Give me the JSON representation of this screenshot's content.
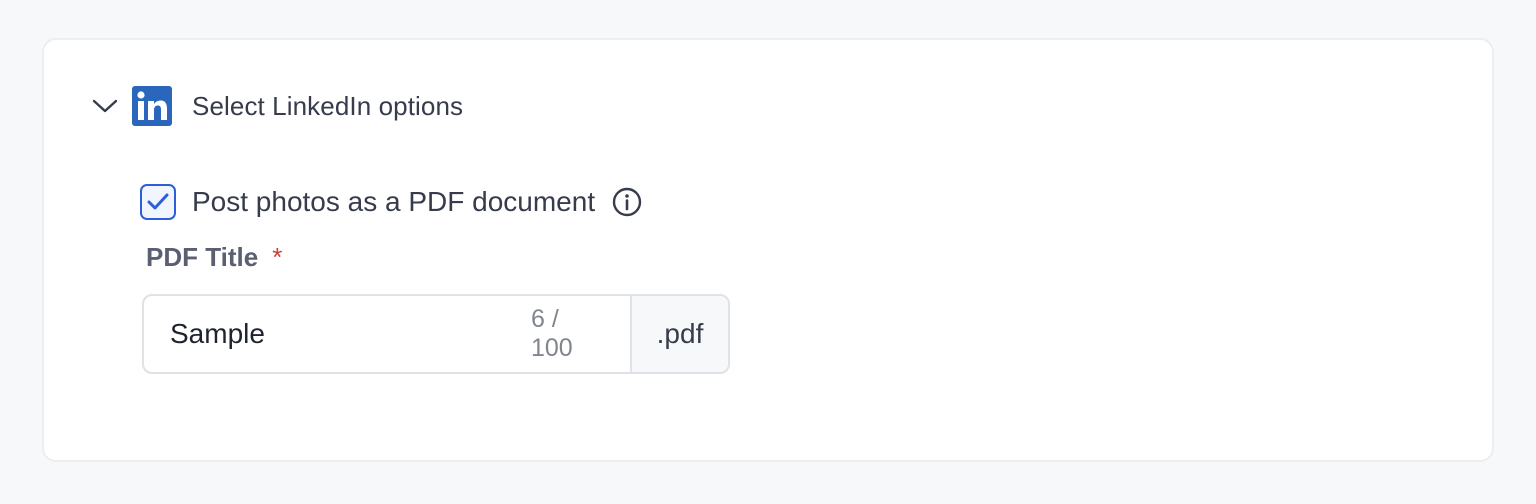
{
  "section": {
    "title": "Select LinkedIn options",
    "expanded": true,
    "brand_color": "#2a66bc",
    "icons": {
      "toggle": "chevron-down-icon",
      "brand": "linkedin-icon"
    }
  },
  "pdf_option": {
    "label": "Post photos as a PDF document",
    "checked": true,
    "accent_color": "#2f5fd8",
    "icons": {
      "check": "checkmark-icon",
      "info": "info-icon"
    }
  },
  "pdf_title": {
    "label": "PDF Title",
    "required_marker": "*",
    "value": "Sample",
    "counter": "6 / 100",
    "suffix": ".pdf"
  }
}
